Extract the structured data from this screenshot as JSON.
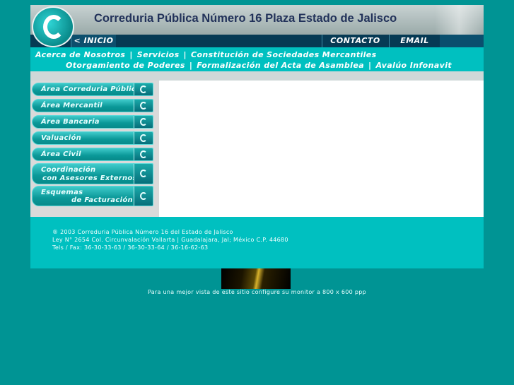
{
  "header": {
    "title": "Correduria Pública Número 16 Plaza Estado de Jalisco"
  },
  "nav": {
    "inicio": "< INICIO",
    "contacto": "CONTACTO",
    "email": "EMAIL"
  },
  "links": {
    "row1": [
      "Acerca de Nosotros",
      "Servicios",
      "Constitución de Sociedades Mercantiles"
    ],
    "row2": [
      "Otorgamiento de Poderes",
      "Formalización del Acta de Asamblea",
      "Avalúo Infonavit"
    ],
    "separator": "|"
  },
  "sidebar": {
    "items": [
      {
        "label": "Área Correduria Pública"
      },
      {
        "label": "Área Mercantil"
      },
      {
        "label": "Área Bancaria"
      },
      {
        "label": "Valuación"
      },
      {
        "label": "Área Civil"
      },
      {
        "label_line1": "Coordinación",
        "label_line2": "con Asesores Externos"
      },
      {
        "label_line1": "Esquemas",
        "label_line2": "de Facturación"
      }
    ]
  },
  "footer": {
    "line1": "® 2003 Correduria Pública Número 16 del Estado de Jalisco",
    "line2": "Ley N° 2654 Col. Circunvalación Vallarta | Guadalajara, Jal; México C.P. 44680",
    "line3": "Tels / Fax: 36-30-33-63 / 36-30-33-64 / 36-16-62-63"
  },
  "monitor_note": "Para una mejor vista de este sitio configure su monitor a 800 x 600 ppp",
  "colors": {
    "background": "#009494",
    "accent": "#00c0c0",
    "navbar": "#063a54"
  }
}
